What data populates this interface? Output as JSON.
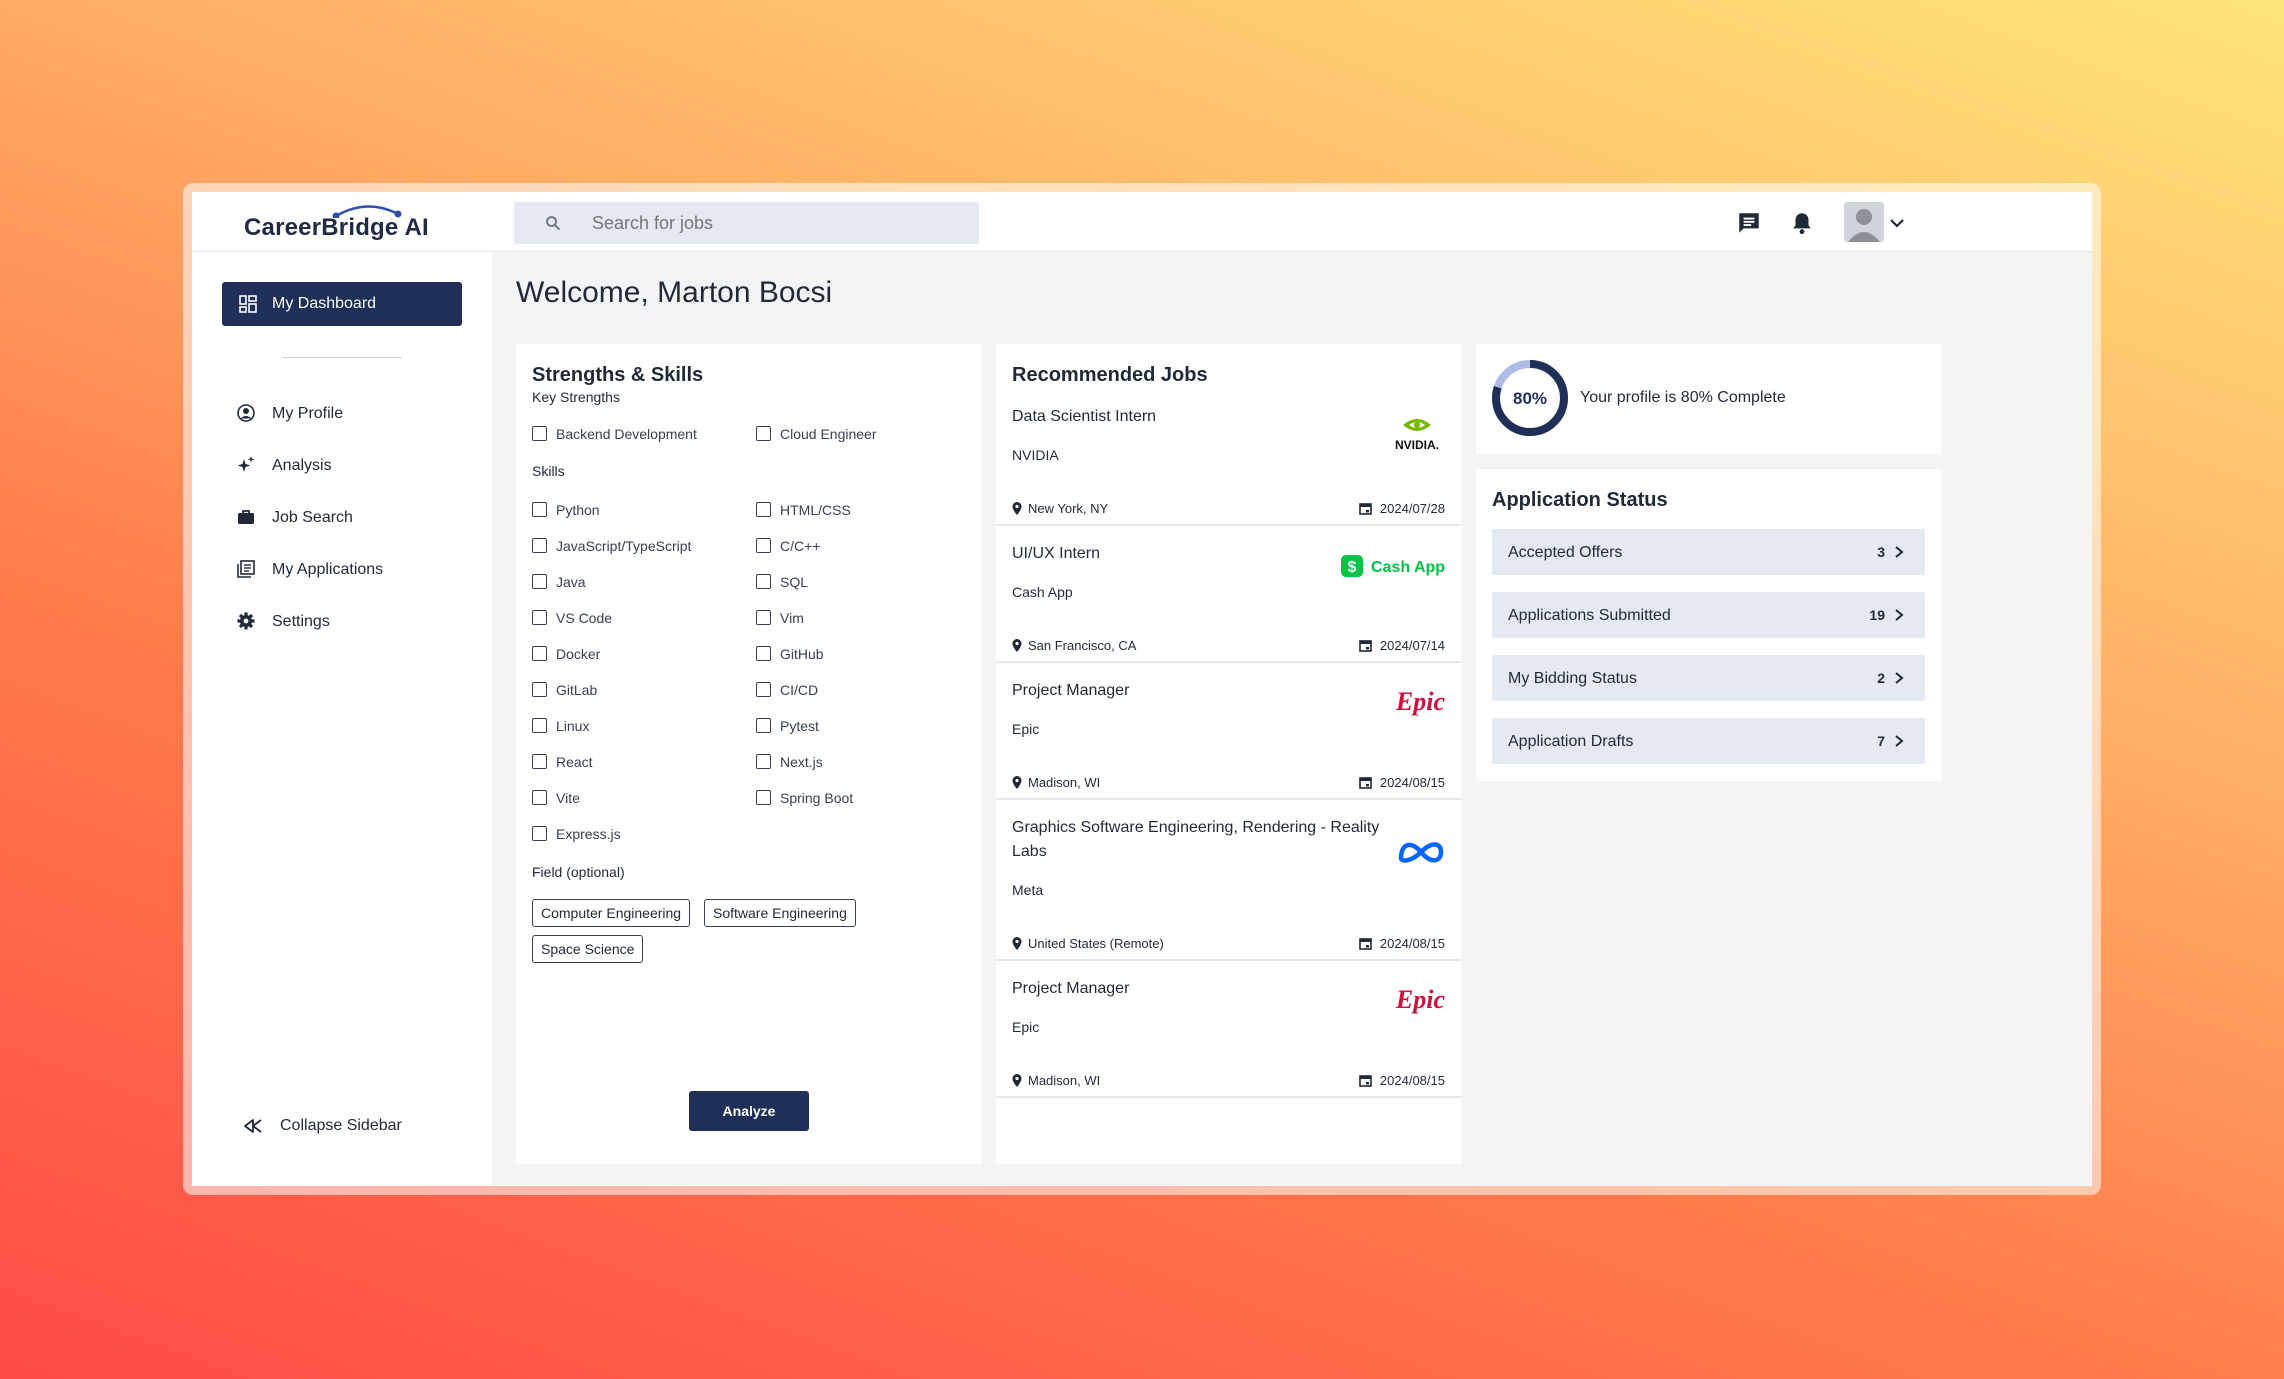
{
  "app": {
    "logo": "CareerBridge AI"
  },
  "search": {
    "placeholder": "Search for jobs"
  },
  "sidebar": {
    "active": {
      "label": "My Dashboard",
      "icon": "dashboard-icon"
    },
    "items": [
      {
        "label": "My Profile",
        "icon": "user-circle-icon"
      },
      {
        "label": "Analysis",
        "icon": "sparkles-icon"
      },
      {
        "label": "Job Search",
        "icon": "briefcase-icon"
      },
      {
        "label": "My Applications",
        "icon": "applications-icon"
      },
      {
        "label": "Settings",
        "icon": "gear-icon"
      }
    ],
    "collapse": "Collapse Sidebar"
  },
  "welcome": "Welcome, Marton Bocsi",
  "skills": {
    "title": "Strengths & Skills",
    "key_strengths_label": "Key Strengths",
    "key_strengths": [
      "Backend Development",
      "Cloud Engineer"
    ],
    "skills_label": "Skills",
    "skills": [
      "Python",
      "HTML/CSS",
      "JavaScript/TypeScript",
      "C/C++",
      "Java",
      "SQL",
      "VS Code",
      "Vim",
      "Docker",
      "GitHub",
      "GitLab",
      "CI/CD",
      "Linux",
      "Pytest",
      "React",
      "Next.js",
      "Vite",
      "Spring Boot",
      "Express.js"
    ],
    "field_label": "Field (optional)",
    "fields": [
      "Computer Engineering",
      "Software Engineering",
      "Space Science"
    ],
    "analyze": "Analyze"
  },
  "jobs": {
    "title": "Recommended Jobs",
    "items": [
      {
        "title": "Data Scientist Intern",
        "company": "NVIDIA",
        "location": "New York, NY",
        "date": "2024/07/28",
        "logo": "NVIDIA."
      },
      {
        "title": "UI/UX Intern",
        "company": "Cash App",
        "location": "San Francisco, CA",
        "date": "2024/07/14",
        "logo": "Cash App"
      },
      {
        "title": "Project Manager",
        "company": "Epic",
        "location": "Madison, WI",
        "date": "2024/08/15",
        "logo": "Epic"
      },
      {
        "title": "Graphics Software Engineering, Rendering - Reality Labs",
        "company": "Meta",
        "location": "United States (Remote)",
        "date": "2024/08/15",
        "logo": "meta"
      },
      {
        "title": "Project Manager",
        "company": "Epic",
        "location": "Madison, WI",
        "date": "2024/08/15",
        "logo": "Epic"
      }
    ]
  },
  "profile": {
    "percent_label": "80%",
    "percent": 0.8,
    "text": "Your profile is 80% Complete"
  },
  "status": {
    "title": "Application Status",
    "rows": [
      {
        "label": "Accepted Offers",
        "count": "3"
      },
      {
        "label": "Applications Submitted",
        "count": "19"
      },
      {
        "label": "My Bidding Status",
        "count": "2"
      },
      {
        "label": "Application Drafts",
        "count": "7"
      }
    ]
  },
  "colors": {
    "primary": "#1f2f58",
    "accent_blue": "#3b5fd0",
    "epic_red": "#d0103a",
    "cashapp_green": "#00c244",
    "nvidia_green": "#76b900",
    "meta_blue": "#0866ff"
  }
}
